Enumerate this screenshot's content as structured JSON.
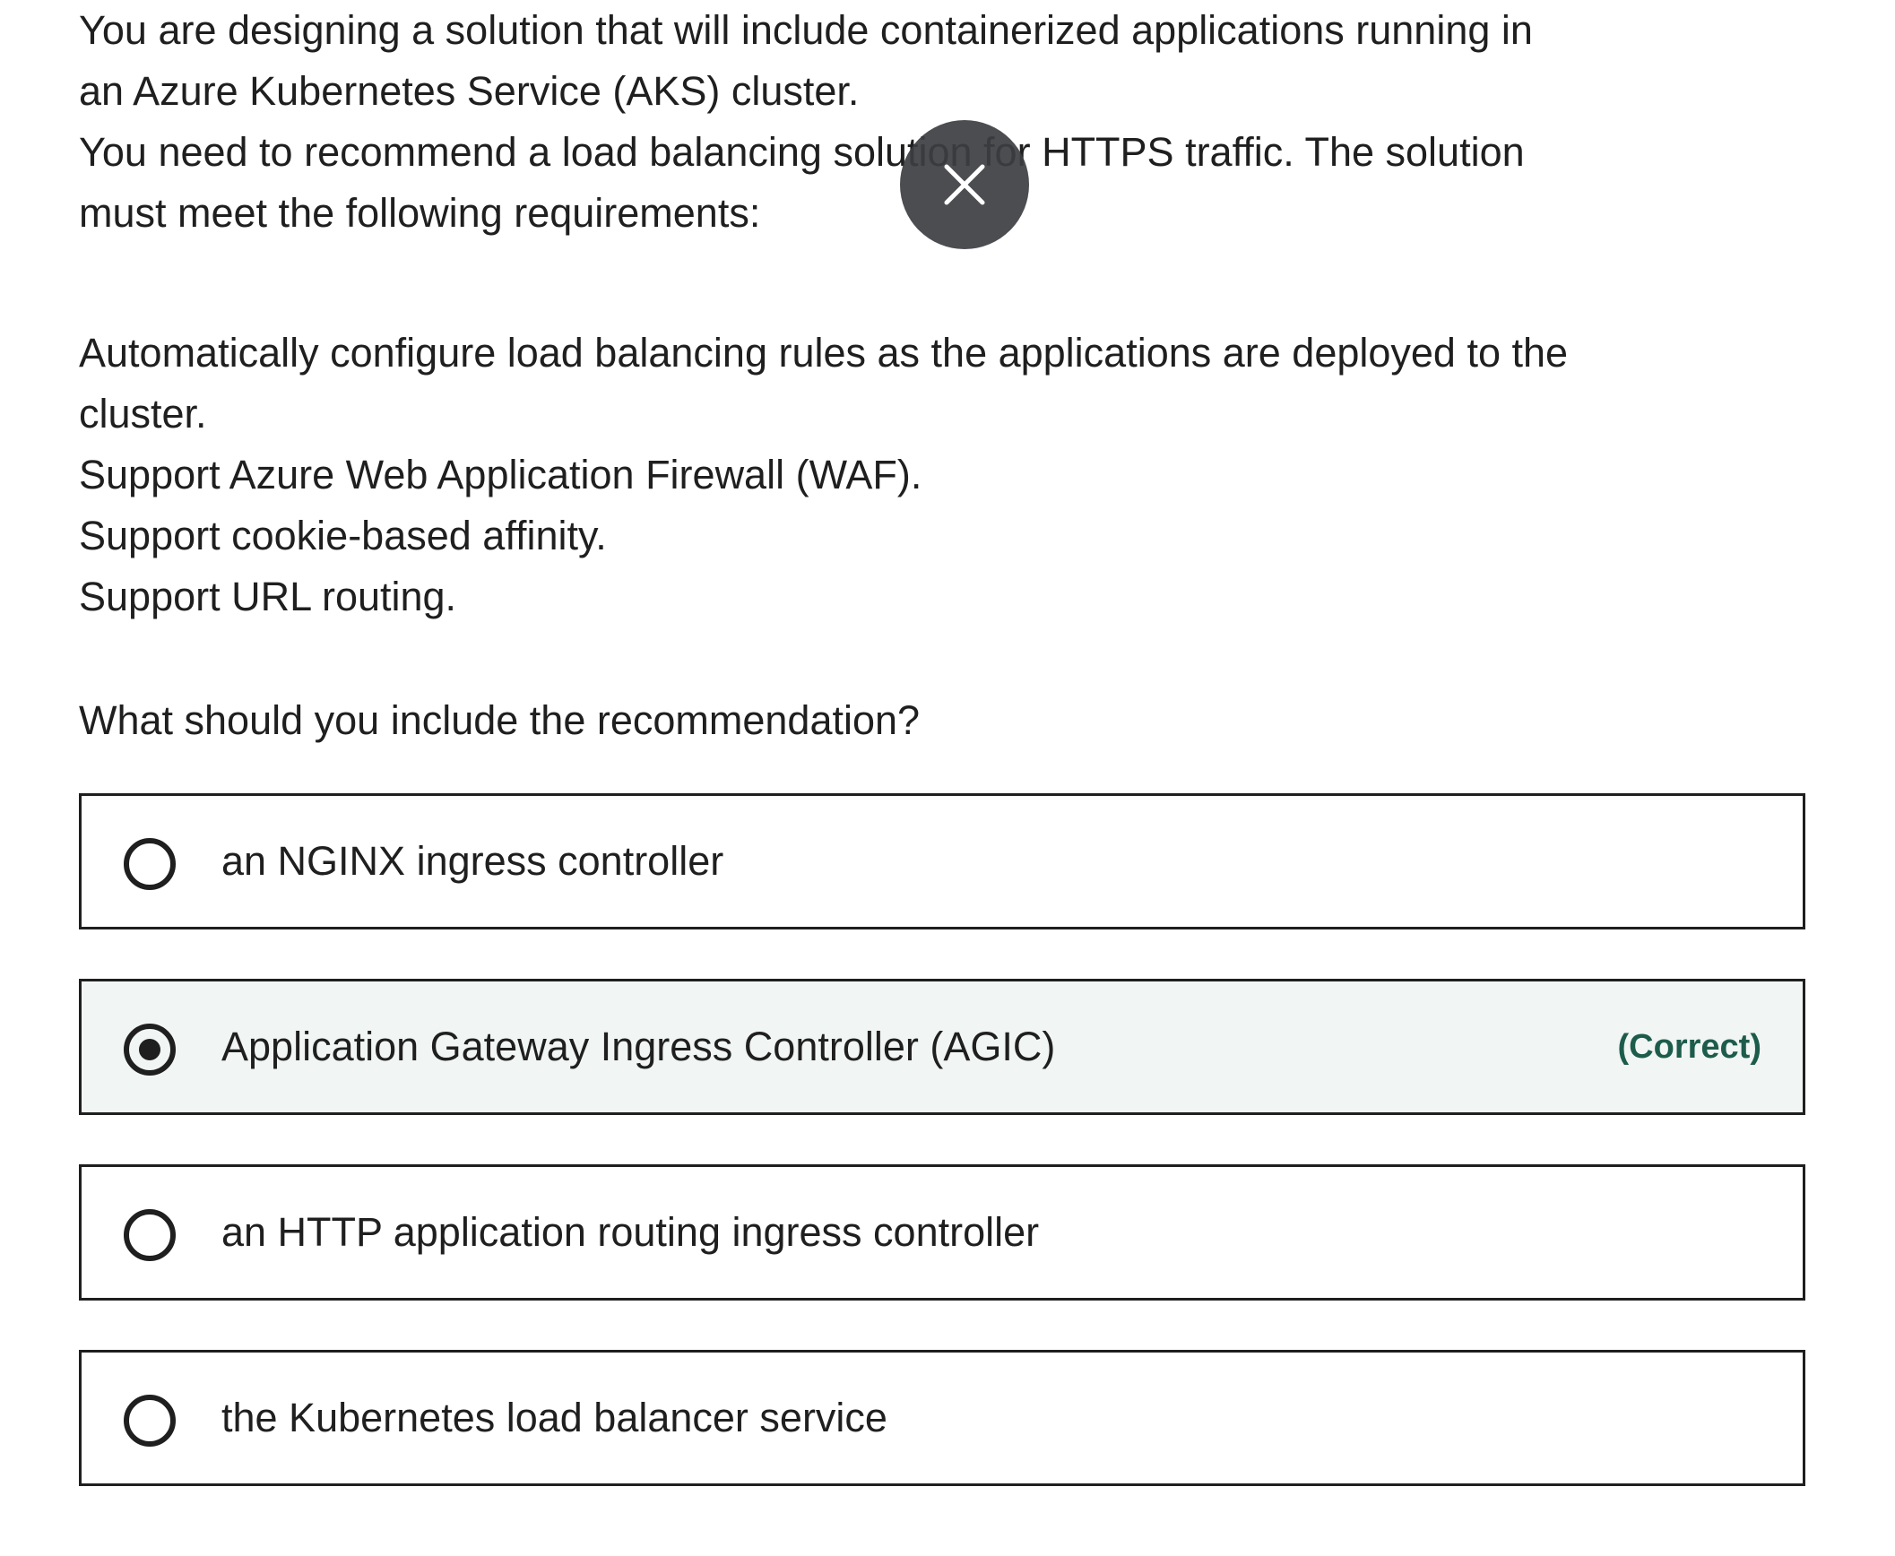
{
  "question": {
    "intro_lines": [
      "You are designing a solution that will include containerized applications running in",
      "an Azure Kubernetes Service (AKS) cluster.",
      "You need to recommend a load balancing solution for HTTPS traffic. The solution",
      "must meet the following requirements:"
    ],
    "requirement_lines": [
      "Automatically configure load balancing rules as the applications are deployed to the",
      "cluster.",
      "Support Azure Web Application Firewall (WAF).",
      "Support cookie-based affinity.",
      "Support URL routing."
    ],
    "prompt": "What should you include the recommendation?"
  },
  "options": [
    {
      "label": "an NGINX ingress controller",
      "selected": false
    },
    {
      "label": "Application Gateway Ingress Controller (AGIC)",
      "selected": true,
      "badge": "(Correct)"
    },
    {
      "label": "an HTTP application routing ingress controller",
      "selected": false
    },
    {
      "label": "the Kubernetes load balancer service",
      "selected": false
    }
  ],
  "overlay": {
    "close_icon": "close-icon"
  },
  "colors": {
    "text": "#1f1f1f",
    "selected_bg": "#f1f5f3",
    "correct_text": "#1d5c4b",
    "close_bg": "#3c3e42"
  }
}
